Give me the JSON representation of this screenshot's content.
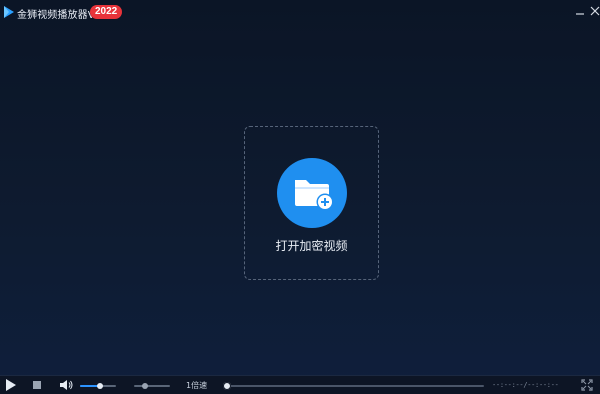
{
  "app": {
    "title": "金狮视频播放器V5.0",
    "year_badge": "2022",
    "accent_color": "#1f8ff0",
    "badge_color": "#e8333a"
  },
  "window_controls": {
    "minimize_icon": "minimize-icon",
    "close_icon": "close-icon"
  },
  "main": {
    "open_label": "打开加密视频",
    "open_icon": "folder-add-icon"
  },
  "controls": {
    "play_icon": "play-icon",
    "stop_icon": "stop-icon",
    "volume_icon": "volume-icon",
    "volume_level": 0.55,
    "secondary_slider_level": 0.3,
    "speed_label": "1倍速",
    "progress_level": 0.0,
    "time_display": "--:--:--/--:--:--",
    "fullscreen_icon": "fullscreen-icon"
  }
}
